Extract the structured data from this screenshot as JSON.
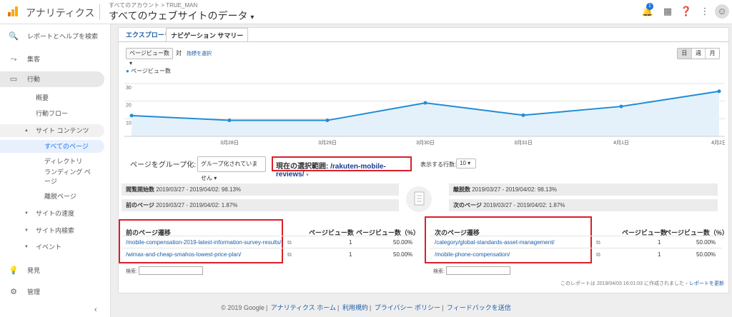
{
  "topbar": {
    "app_name": "アナリティクス",
    "account_path": "すべてのアカウント > TRUE_MAN",
    "property": "すべてのウェブサイトのデータ",
    "property_caret": "▾",
    "notification_count": "1"
  },
  "sidebar": {
    "search": "レポートとヘルプを検索",
    "items": [
      "集客",
      "行動",
      "サイト コンテンツ",
      "すべてのページ",
      "ディレクトリ",
      "ランディング ページ",
      "離脱ページ",
      "サイトの速度",
      "サイト内検索",
      "イベント",
      "発見",
      "管理",
      "概要",
      "行動フロー"
    ]
  },
  "tabs": [
    "エクスプローラ",
    "ナビゲーション サマリー"
  ],
  "controls": {
    "metric_select": "ページビュー数",
    "vs_label": "対",
    "add_metric": "指標を選択",
    "periods": [
      "日",
      "週",
      "月"
    ]
  },
  "chart_data": {
    "type": "line",
    "series": [
      {
        "name": "ページビュー数",
        "values": [
          11.8,
          9.1,
          9.1,
          19.0,
          12.0,
          17.0,
          25.6
        ]
      }
    ],
    "x": [
      "2019/03/27",
      "2019/03/28",
      "2019/03/29",
      "2019/03/30",
      "2019/03/31",
      "2019/04/01",
      "2019/04/02"
    ],
    "x_tick_labels": [
      "3月28日",
      "3月29日",
      "3月30日",
      "3月31日",
      "4月1日",
      "4月2日"
    ],
    "y_ticks": [
      "30",
      "20",
      "10"
    ],
    "ylim": [
      0,
      30
    ],
    "color": "#1f8dd6"
  },
  "grouping": {
    "label": "ページをグループ化:",
    "select": "グループ化されていません",
    "current_label": "現在の選択範囲:",
    "current_value": "/rakuten-mobile-reviews/",
    "rows_label": "表示する行数:",
    "rows_value": "10"
  },
  "stats": {
    "entrance_label": "閲覧開始数",
    "entrance_value": "2019/03/27 - 2019/04/02: 98.13%",
    "prev_label": "前のページ",
    "prev_value": "2019/03/27 - 2019/04/02: 1.87%",
    "exit_label": "離脱数",
    "exit_value": "2019/03/27 - 2019/04/02: 98.13%",
    "next_label": "次のページ",
    "next_value": "2019/03/27 - 2019/04/02: 1.87%"
  },
  "prev_table": {
    "header": "前のページ遷移",
    "col1": "ページビュー数",
    "col2": "ページビュー数（%）",
    "rows": [
      {
        "path": "/mobile-compensation-2019-latest-information-survey-results/",
        "pv": "1",
        "pct": "50.00%"
      },
      {
        "path": "/wimax-and-cheap-smahos-lowest-price-plan/",
        "pv": "1",
        "pct": "50.00%"
      }
    ]
  },
  "next_table": {
    "header": "次のページ遷移",
    "col1": "ページビュー数",
    "col2": "ページビュー数（%）",
    "rows": [
      {
        "path": "/category/global-standards-asset-management/",
        "pv": "1",
        "pct": "50.00%"
      },
      {
        "path": "/mobile-phone-compensation/",
        "pv": "1",
        "pct": "50.00%"
      }
    ]
  },
  "search_label": "検索:",
  "report_note": "このレポートは 2019/04/03 16:01:03 に作成されました・",
  "refresh_link": "レポートを更新",
  "footer": {
    "copyright": "© 2019 Google",
    "links": [
      "アナリティクス ホーム",
      "利用規約",
      "プライバシー ポリシー",
      "フィードバックを送信"
    ]
  }
}
